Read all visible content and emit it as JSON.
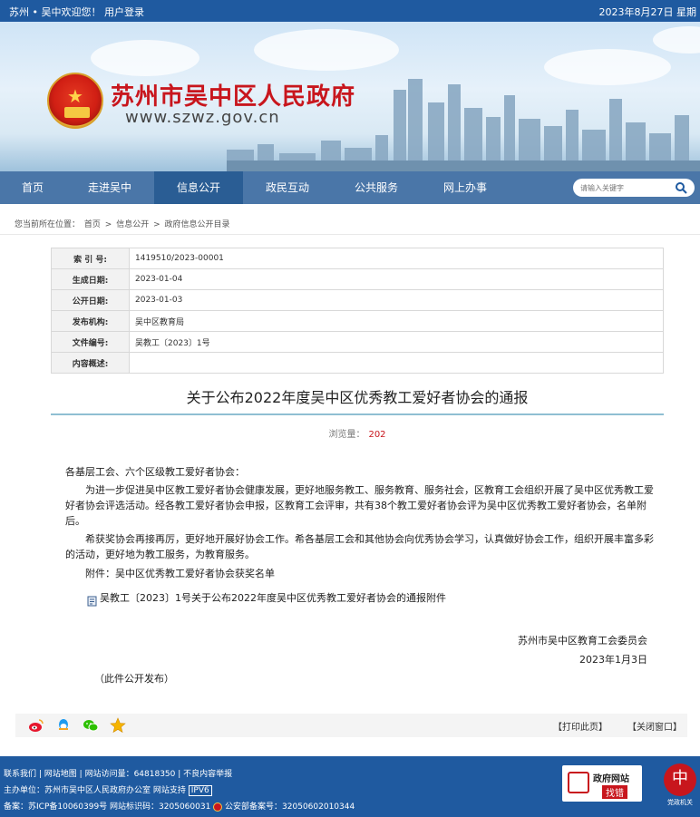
{
  "topbar": {
    "welcome": "苏州 • 吴中欢迎您！ 用户登录",
    "date": "2023年8月27日 星期"
  },
  "header": {
    "site_title": "苏州市吴中区人民政府",
    "site_url": "www.szwz.gov.cn"
  },
  "nav": {
    "items": [
      "首页",
      "走进吴中",
      "信息公开",
      "政民互动",
      "公共服务",
      "网上办事"
    ],
    "active": "信息公开"
  },
  "search": {
    "placeholder": "请输入关键字"
  },
  "breadcrumb": {
    "label": "您当前所在位置：",
    "items": [
      "首页",
      "信息公开",
      "政府信息公开目录"
    ],
    "sep": ">"
  },
  "meta": {
    "rows": [
      {
        "key": "索 引 号:",
        "value": "1419510/2023-00001"
      },
      {
        "key": "生成日期:",
        "value": "2023-01-04"
      },
      {
        "key": "公开日期:",
        "value": "2023-01-03"
      },
      {
        "key": "发布机构:",
        "value": "吴中区教育局"
      },
      {
        "key": "文件编号:",
        "value": "吴教工〔2023〕1号"
      },
      {
        "key": "内容概述:",
        "value": ""
      }
    ]
  },
  "article": {
    "title": "关于公布2022年度吴中区优秀教工爱好者协会的通报",
    "views_label": "浏览量：",
    "views": "202",
    "salutation": "各基层工会、六个区级教工爱好者协会：",
    "para1": "为进一步促进吴中区教工爱好者协会健康发展，更好地服务教工、服务教育、服务社会，区教育工会组织开展了吴中区优秀教工爱好者协会评选活动。经各教工爱好者协会申报，区教育工会评审，共有38个教工爱好者协会评为吴中区优秀教工爱好者协会，名单附后。",
    "para2": "希获奖协会再接再厉，更好地开展好协会工作。希各基层工会和其他协会向优秀协会学习，认真做好协会工作，组织开展丰富多彩的活动，更好地为教工服务，为教育服务。",
    "attachment_line": "附件：吴中区优秀教工爱好者协会获奖名单",
    "attachment_file": "吴教工〔2023〕1号关于公布2022年度吴中区优秀教工爱好者协会的通报附件",
    "signer": "苏州市吴中区教育工会委员会",
    "sign_date": "2023年1月3日",
    "note": "（此件公开发布）"
  },
  "actions": {
    "print": "【打印此页】",
    "close": "【关闭窗口】"
  },
  "share": {
    "icons": [
      "weibo-icon",
      "qq-icon",
      "wechat-icon",
      "favorite-star-icon"
    ]
  },
  "footer": {
    "links": [
      "联系我们",
      "网站地图",
      "网站访问量：64818350",
      "不良内容举报"
    ],
    "sponsor": "主办单位：苏州市吴中区人民政府办公室  网站支持",
    "ipv6": "IPV6",
    "icp": "备案：苏ICP备10060399号 网站标识码：3205060031",
    "police": "公安部备案号：32050602010344",
    "badge1_title": "政府网站",
    "badge1_sub": "找错",
    "badge2_caption": "党政机关"
  },
  "colors": {
    "topbar": "#1f5aa0",
    "nav": "#4a76a8",
    "nav_active": "#2a5d94",
    "title_red": "#c8161d",
    "views_red": "#c8161d",
    "title_rule": "#8fbfd2"
  }
}
